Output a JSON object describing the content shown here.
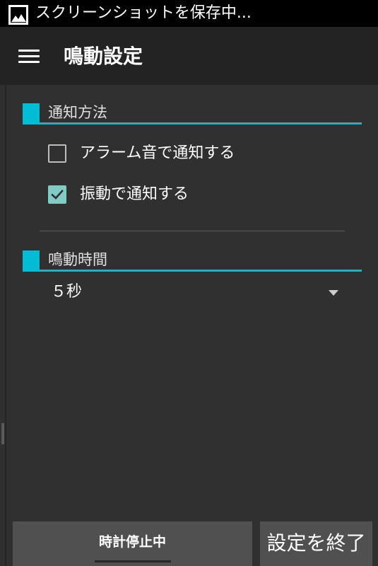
{
  "status_bar": {
    "notification_text": "スクリーンショットを保存中...",
    "icon": "image-icon"
  },
  "app_bar": {
    "menu_icon": "hamburger-menu-icon",
    "title": "鳴動設定"
  },
  "sections": {
    "notification": {
      "title": "通知方法",
      "items": [
        {
          "label": "アラーム音で通知する",
          "checked": false
        },
        {
          "label": "振動で通知する",
          "checked": true
        }
      ]
    },
    "duration": {
      "title": "鳴動時間",
      "selected_value": "５秒"
    }
  },
  "buttons": {
    "stop_clock": "時計停止中",
    "end_settings": "設定を終了"
  },
  "colors": {
    "accent": "#00bcd4",
    "checkbox_checked": "#80cbc4",
    "background": "#303030",
    "app_bar": "#232323",
    "status_bar": "#000000",
    "button": "#505050"
  }
}
